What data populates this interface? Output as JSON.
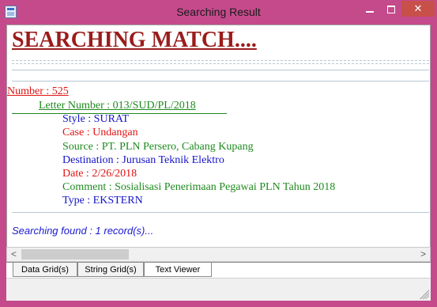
{
  "window": {
    "title": "Searching Result",
    "close_glyph": "✕",
    "icons": [
      "app-icon",
      "minimize-icon",
      "maximize-icon",
      "close-icon"
    ]
  },
  "viewer": {
    "heading": "SEARCHING MATCH....",
    "number_line": "Number : 525",
    "letter_number_line": "Letter Number : 013/SUD/PL/2018",
    "style_line": "Style : SURAT",
    "case_line": "Case : Undangan",
    "source_line": "Source : PT. PLN Persero, Cabang Kupang",
    "destination_line": "Destination : Jurusan Teknik Elektro",
    "date_line": "Date : 2/26/2018",
    "comment_line": "Comment : Sosialisasi Penerimaan Pegawai PLN Tahun 2018",
    "type_line": "Type : EKSTERN",
    "found_text": "Searching found : 1 record(s)..."
  },
  "scrollbar": {
    "left_arrow": "<",
    "right_arrow": ">"
  },
  "tabs": [
    {
      "label": "Data Grid(s)"
    },
    {
      "label": "String Grid(s)"
    },
    {
      "label": "Text Viewer",
      "active": true
    }
  ],
  "colors": {
    "titlebar": "#c54a8c",
    "heading": "#9a1c1c",
    "red_text": "#e01414",
    "green_text": "#1e8a1e",
    "blue_text": "#1414c8",
    "close_button": "#c7504a"
  }
}
